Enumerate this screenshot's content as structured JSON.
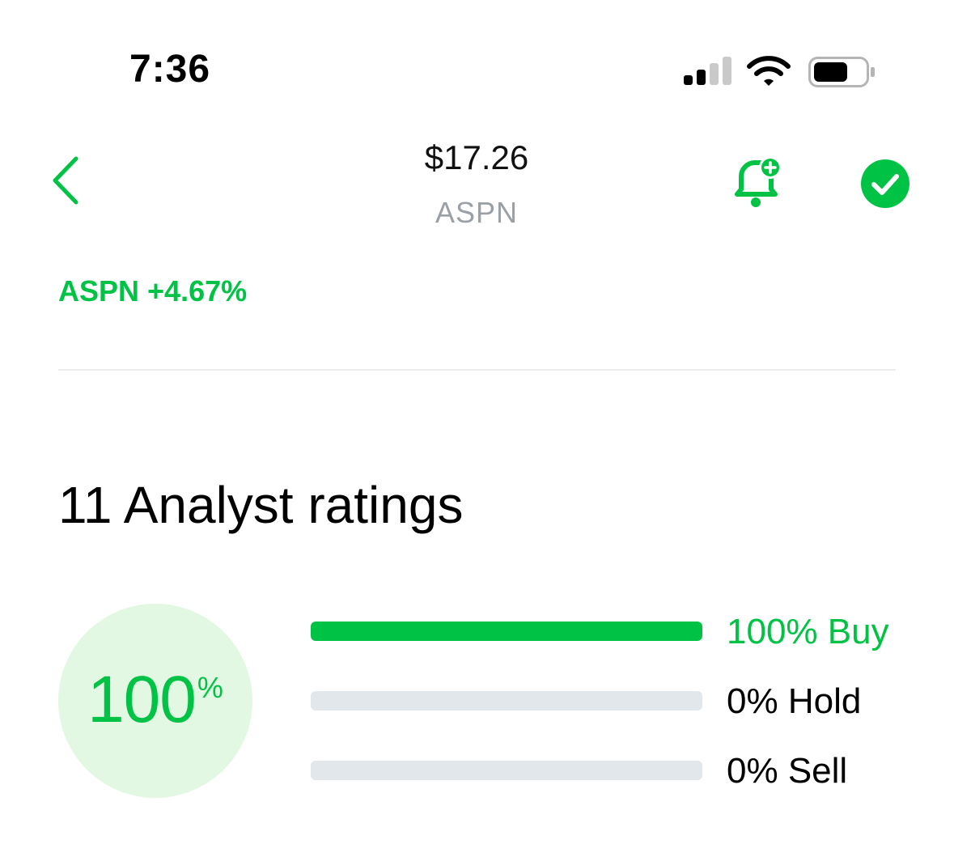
{
  "status_bar": {
    "time": "7:36",
    "signal_icon": "cellular-signal-icon",
    "wifi_icon": "wifi-icon",
    "battery_icon": "battery-icon"
  },
  "header": {
    "back_icon": "chevron-left-icon",
    "price": "$17.26",
    "symbol": "ASPN",
    "alert_icon": "bell-plus-icon",
    "watchlist_icon": "check-circle-icon"
  },
  "ticker_change": "ASPN +4.67%",
  "analyst": {
    "title": "11 Analyst ratings",
    "score_value": "100",
    "score_unit": "%",
    "ratings": [
      {
        "label": "100% Buy",
        "fraction": 1.0,
        "color": "#00c244"
      },
      {
        "label": "0% Hold",
        "fraction": 0.0,
        "color": "#000000"
      },
      {
        "label": "0% Sell",
        "fraction": 0.0,
        "color": "#000000"
      }
    ]
  },
  "colors": {
    "accent": "#00c244",
    "score_bg": "#e3f8e3",
    "track": "#e2e7ec",
    "muted": "#9aa0a6"
  }
}
